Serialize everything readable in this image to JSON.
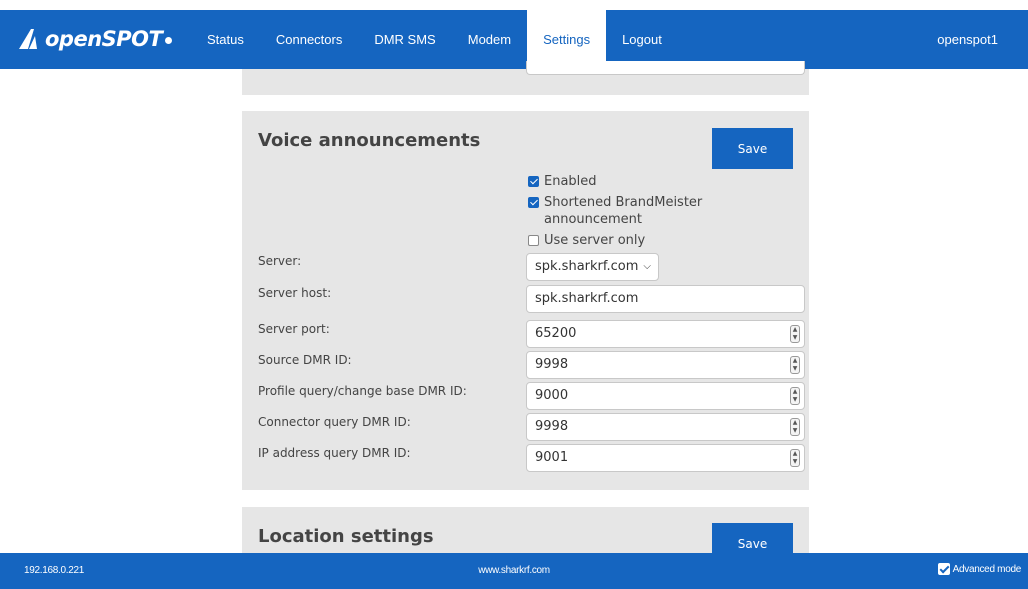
{
  "brand": {
    "name": "openSPOT"
  },
  "nav": {
    "items": [
      {
        "label": "Status",
        "active": false
      },
      {
        "label": "Connectors",
        "active": false
      },
      {
        "label": "DMR SMS",
        "active": false
      },
      {
        "label": "Modem",
        "active": false
      },
      {
        "label": "Settings",
        "active": true
      },
      {
        "label": "Logout",
        "active": false
      }
    ],
    "user": "openspot1"
  },
  "voice": {
    "title": "Voice announcements",
    "save_label": "Save",
    "enabled": {
      "label": "Enabled",
      "checked": true
    },
    "shortened": {
      "label": "Shortened BrandMeister announcement",
      "checked": true
    },
    "server_only": {
      "label": "Use server only",
      "checked": false
    },
    "server": {
      "label": "Server:",
      "value": "spk.sharkrf.com"
    },
    "server_host": {
      "label": "Server host:",
      "value": "spk.sharkrf.com"
    },
    "server_port": {
      "label": "Server port:",
      "value": "65200"
    },
    "source_dmr_id": {
      "label": "Source DMR ID:",
      "value": "9998"
    },
    "profile_dmr_id": {
      "label": "Profile query/change base DMR ID:",
      "value": "9000"
    },
    "connector_dmr_id": {
      "label": "Connector query DMR ID:",
      "value": "9998"
    },
    "ip_dmr_id": {
      "label": "IP address query DMR ID:",
      "value": "9001"
    }
  },
  "location": {
    "title": "Location settings",
    "save_label": "Save"
  },
  "footer": {
    "ip": "192.168.0.221",
    "site": "www.sharkrf.com",
    "advanced_mode": {
      "label": "Advanced mode",
      "checked": true
    }
  },
  "colors": {
    "primary": "#1565c0",
    "panel": "#e6e6e6"
  }
}
